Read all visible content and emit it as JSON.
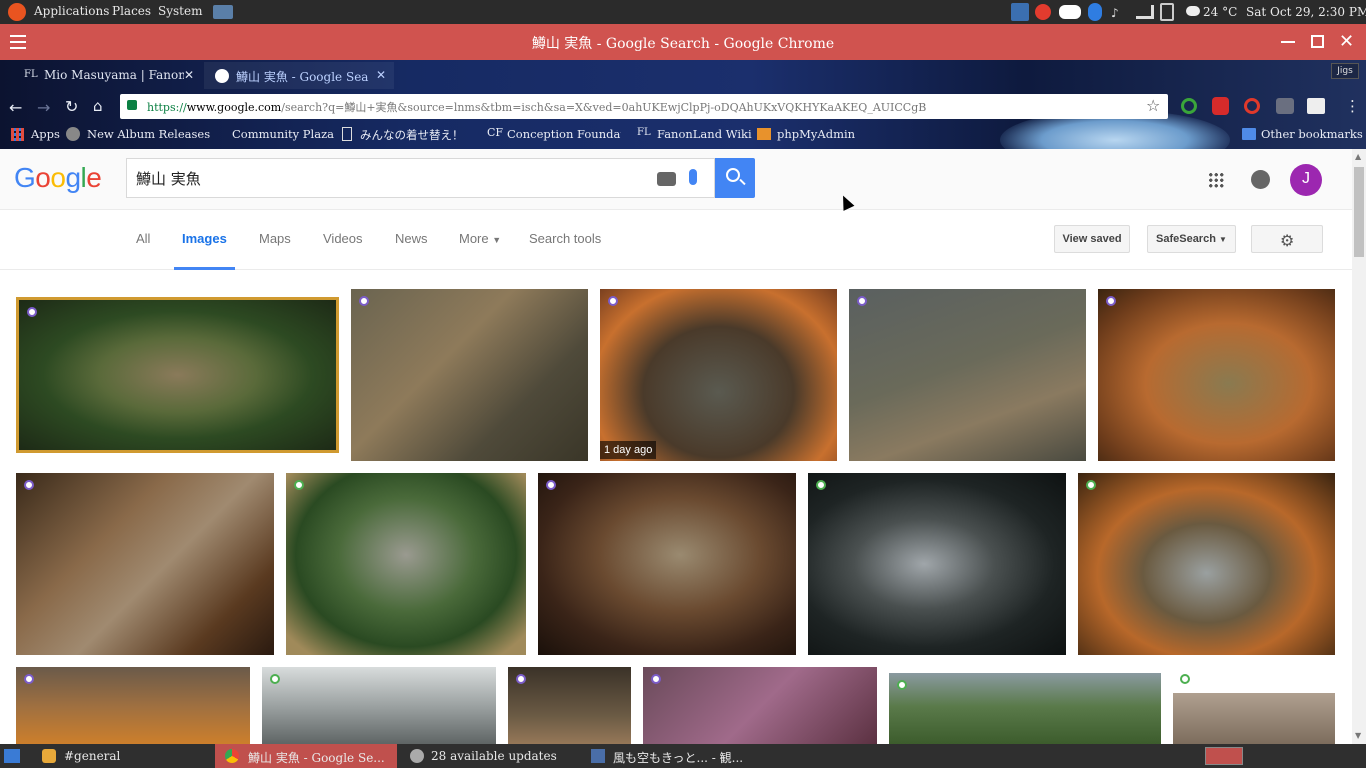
{
  "os_panel": {
    "menus": [
      "Applications",
      "Places",
      "System"
    ],
    "weather": "24 °C",
    "clock": "Sat Oct 29,  2:30 PM"
  },
  "window": {
    "title": "鱒山 実魚 - Google Search - Google Chrome"
  },
  "tabs": [
    {
      "label": "Mio Masuyama | FanonL"
    },
    {
      "label": "鱒山 実魚 - Google Sea"
    }
  ],
  "profile_label": "Jigs",
  "address": {
    "scheme": "https://",
    "domain": "www.google.com",
    "path": "/search?q=鱒山+実魚&source=lnms&tbm=isch&sa=X&ved=0ahUKEwjClpPj-oDQAhUKxVQKHYKaAKEQ_AUICCgB"
  },
  "bookmarks": {
    "items": [
      "Apps",
      "New Album Releases",
      "Community Plaza",
      "みんなの着せ替え！",
      "Conception Foundatio",
      "FanonLand Wiki",
      "phpMyAdmin"
    ],
    "other": "Other bookmarks"
  },
  "google": {
    "logo_letters": [
      "G",
      "o",
      "o",
      "g",
      "l",
      "e"
    ],
    "logo_colors": [
      "#4285f4",
      "#ea4335",
      "#fbbc05",
      "#4285f4",
      "#34a853",
      "#ea4335"
    ],
    "query": "鱒山 実魚",
    "avatar_letter": "J",
    "nav": [
      "All",
      "Images",
      "Maps",
      "Videos",
      "News",
      "More",
      "Search tools"
    ],
    "active_nav": "Images",
    "view_saved": "View saved",
    "safesearch": "SafeSearch"
  },
  "results": {
    "badge": "1 day ago"
  },
  "taskbar": {
    "items": [
      "#general",
      "鱒山 実魚 - Google Se...",
      "28 available updates",
      "風も空もきっと... - 観..."
    ]
  }
}
